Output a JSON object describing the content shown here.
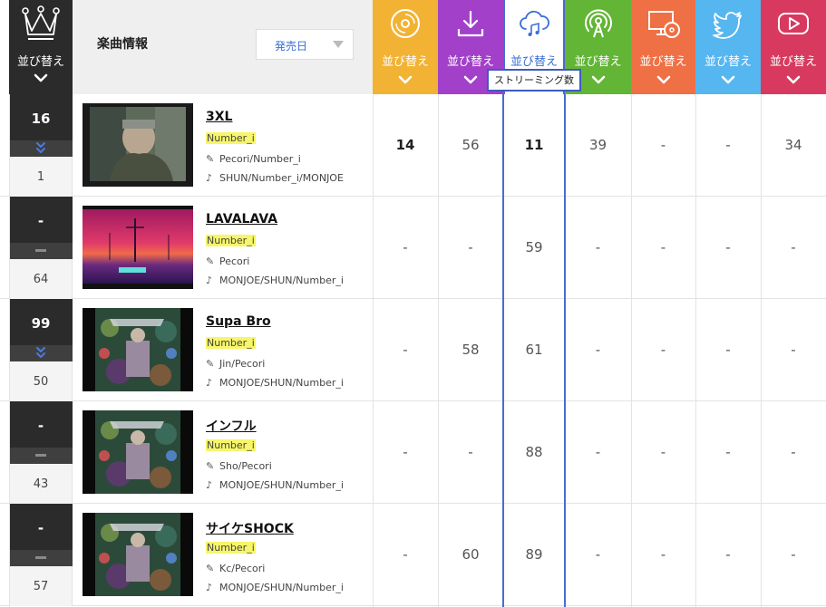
{
  "header": {
    "sort_label": "並び替え",
    "song_info_label": "楽曲情報",
    "sort_select": "発売日",
    "tooltip": "ストリーミング数"
  },
  "metric_columns": [
    {
      "icon": "cd-disc-icon",
      "color": "#f2b233",
      "label": "並び替え"
    },
    {
      "icon": "download-icon",
      "color": "#a240c9",
      "label": "並び替え"
    },
    {
      "icon": "cloud-music-icon",
      "color": "#ffffff",
      "label": "並び替え",
      "selected": true
    },
    {
      "icon": "radio-broadcast-icon",
      "color": "#62b535",
      "label": "並び替え"
    },
    {
      "icon": "pc-disc-icon",
      "color": "#ef7045",
      "label": "並び替え"
    },
    {
      "icon": "twitter-bird-icon",
      "color": "#56b6f0",
      "label": "並び替え"
    },
    {
      "icon": "youtube-play-icon",
      "color": "#d73a5e",
      "label": "並び替え"
    }
  ],
  "rows": [
    {
      "rank": "16",
      "trend": "down",
      "prev": "1",
      "title": "3XL",
      "artist": "Number_i",
      "lyricist": "Pecori/Number_i",
      "composer": "SHUN/Number_i/MONJOE",
      "values": [
        "14",
        "56",
        "11",
        "39",
        "-",
        "-",
        "34"
      ],
      "bold_first": true,
      "thumb": "photo"
    },
    {
      "rank": "-",
      "trend": "flat",
      "prev": "64",
      "title": "LAVALAVA",
      "artist": "Number_i",
      "lyricist": "Pecori",
      "composer": "MONJOE/SHUN/Number_i",
      "values": [
        "-",
        "-",
        "59",
        "-",
        "-",
        "-",
        "-"
      ],
      "bold_first": false,
      "thumb": "sunset"
    },
    {
      "rank": "99",
      "trend": "down",
      "prev": "50",
      "title": "Supa Bro",
      "artist": "Number_i",
      "lyricist": "Jin/Pecori",
      "composer": "MONJOE/SHUN/Number_i",
      "values": [
        "-",
        "58",
        "61",
        "-",
        "-",
        "-",
        "-"
      ],
      "bold_first": false,
      "thumb": "album"
    },
    {
      "rank": "-",
      "trend": "flat",
      "prev": "43",
      "title": "インフル",
      "artist": "Number_i",
      "lyricist": "Sho/Pecori",
      "composer": "MONJOE/SHUN/Number_i",
      "values": [
        "-",
        "-",
        "88",
        "-",
        "-",
        "-",
        "-"
      ],
      "bold_first": false,
      "thumb": "album"
    },
    {
      "rank": "-",
      "trend": "flat",
      "prev": "57",
      "title": "サイケSHOCK",
      "artist": "Number_i",
      "lyricist": "Kc/Pecori",
      "composer": "MONJOE/SHUN/Number_i",
      "values": [
        "-",
        "60",
        "89",
        "-",
        "-",
        "-",
        "-"
      ],
      "bold_first": false,
      "thumb": "album"
    }
  ],
  "colors": {
    "rank_bg": "#2b2b2b",
    "selected_border": "#4a6bd1",
    "artist_highlight": "#f7f56a"
  }
}
